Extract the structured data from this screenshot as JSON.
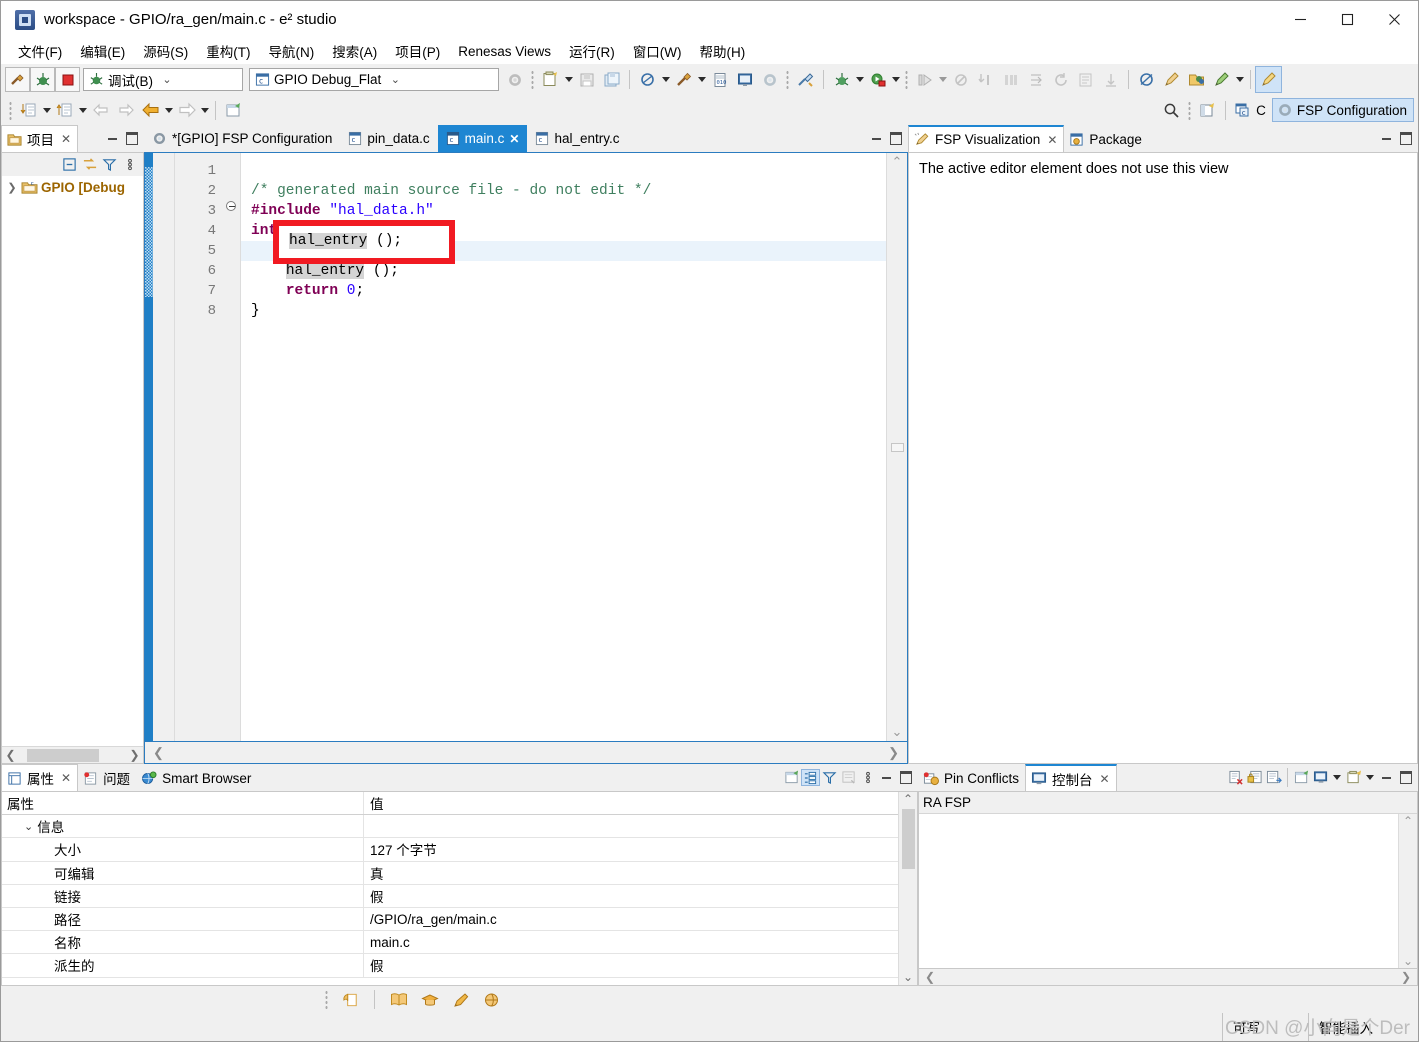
{
  "window": {
    "title": "workspace - GPIO/ra_gen/main.c - e² studio",
    "app_icon": "e2studio-icon",
    "controls": {
      "minimize": "minimize-icon",
      "maximize": "maximize-icon",
      "close": "close-icon"
    }
  },
  "menubar": [
    {
      "label": "文件(F)",
      "name": "menu-file"
    },
    {
      "label": "编辑(E)",
      "name": "menu-edit"
    },
    {
      "label": "源码(S)",
      "name": "menu-source"
    },
    {
      "label": "重构(T)",
      "name": "menu-refactor"
    },
    {
      "label": "导航(N)",
      "name": "menu-navigate"
    },
    {
      "label": "搜索(A)",
      "name": "menu-search"
    },
    {
      "label": "项目(P)",
      "name": "menu-project"
    },
    {
      "label": "Renesas Views",
      "name": "menu-renesas-views"
    },
    {
      "label": "运行(R)",
      "name": "menu-run"
    },
    {
      "label": "窗口(W)",
      "name": "menu-window"
    },
    {
      "label": "帮助(H)",
      "name": "menu-help"
    }
  ],
  "toolbar": {
    "build_tip": "build-icon",
    "debug_tip": "debug-bug-icon",
    "stop_tip": "stop-icon",
    "launch_mode": {
      "value": "调试(B)",
      "icon": "debug-bug-icon"
    },
    "launch_config": {
      "value": "GPIO Debug_Flat",
      "icon": "c-project-icon"
    }
  },
  "perspective": {
    "search_icon": "search-icon",
    "open_perspective": "open-perspective-icon",
    "items": [
      {
        "label": "C",
        "icon": "c-perspective-icon",
        "active": false
      },
      {
        "label": "FSP Configuration",
        "icon": "gear-icon",
        "active": true
      }
    ]
  },
  "project_explorer": {
    "tab_label": "项目",
    "tab_icon": "project-explorer-icon",
    "tree": [
      {
        "label": "GPIO [Debug",
        "suffix": "",
        "expander": "collapsed"
      }
    ]
  },
  "editor": {
    "tabs": [
      {
        "label": "*[GPIO] FSP Configuration",
        "icon": "gear-icon",
        "active": false,
        "closeable": false
      },
      {
        "label": "pin_data.c",
        "icon": "c-file-icon",
        "active": false,
        "closeable": false
      },
      {
        "label": "main.c",
        "icon": "c-file-icon",
        "active": true,
        "closeable": true
      },
      {
        "label": "hal_entry.c",
        "icon": "c-file-icon",
        "active": false,
        "closeable": false
      }
    ],
    "line_numbers": [
      "1",
      "2",
      "3",
      "4",
      "5",
      "6",
      "7",
      "8"
    ],
    "code_lines": [
      {
        "n": 1,
        "text": "/* generated main source file - do not edit */"
      },
      {
        "n": 2,
        "text": "#include \"hal_data.h\""
      },
      {
        "n": 3,
        "text": "int main(void)"
      },
      {
        "n": 4,
        "text": "{"
      },
      {
        "n": 5,
        "text": "    hal_entry ();"
      },
      {
        "n": 6,
        "text": "    return 0;"
      },
      {
        "n": 7,
        "text": "}"
      },
      {
        "n": 8,
        "text": ""
      }
    ],
    "highlighted_token": "hal_entry",
    "annotation": {
      "shape": "rectangle",
      "color": "#f11a22",
      "target_line": 5
    },
    "current_line": 5
  },
  "right_view": {
    "tabs": [
      {
        "label": "FSP Visualization",
        "icon": "pencil-visualization-icon",
        "active": true,
        "closeable": true
      },
      {
        "label": "Package",
        "icon": "package-icon",
        "active": false,
        "closeable": false
      }
    ],
    "message": "The active editor element does not use this view"
  },
  "properties_view": {
    "tabs": [
      {
        "label": "属性",
        "icon": "properties-icon",
        "active": true,
        "closeable": true
      },
      {
        "label": "问题",
        "icon": "problems-icon",
        "active": false,
        "closeable": false
      },
      {
        "label": "Smart Browser",
        "icon": "smart-browser-icon",
        "active": false,
        "closeable": false
      }
    ],
    "columns": [
      "属性",
      "值"
    ],
    "rows": [
      {
        "indent": 0,
        "name": "信息",
        "value": "",
        "expander": "expanded"
      },
      {
        "indent": 1,
        "name": "大小",
        "value": "127 个字节"
      },
      {
        "indent": 1,
        "name": "可编辑",
        "value": "真"
      },
      {
        "indent": 1,
        "name": "链接",
        "value": "假"
      },
      {
        "indent": 1,
        "name": "路径",
        "value": "/GPIO/ra_gen/main.c"
      },
      {
        "indent": 1,
        "name": "名称",
        "value": "main.c"
      },
      {
        "indent": 1,
        "name": "派生的",
        "value": "假"
      }
    ],
    "toolbar_icons": [
      "pin-icon",
      "show-categories-icon",
      "filter-icon",
      "restore-defaults-icon",
      "view-menu-icon",
      "minimize-icon",
      "maximize-icon"
    ]
  },
  "console_view": {
    "tabs": [
      {
        "label": "Pin Conflicts",
        "icon": "pin-conflicts-icon",
        "active": false,
        "closeable": false
      },
      {
        "label": "控制台",
        "icon": "console-icon",
        "active": true,
        "closeable": true
      }
    ],
    "console_name": "RA FSP",
    "content": "",
    "toolbar_icons": [
      "clear-console-icon",
      "lock-scroll-icon",
      "show-console-icon",
      "pin-console-icon",
      "display-selected-console-icon",
      "open-console-icon",
      "minimize-icon",
      "maximize-icon"
    ]
  },
  "bottom_strip_icons": [
    "page-icon",
    "book-icon",
    "graduation-cap-icon",
    "pencil-icon",
    "globe-icon"
  ],
  "statusbar": {
    "writable": "可写",
    "insert_mode": "智能插入"
  },
  "watermark": "CSDN @小向是个Der",
  "colors": {
    "accent_blue": "#1e86d2",
    "annotation_red": "#f11a22",
    "comment_green": "#3f7f5f",
    "keyword_purple": "#7f0055",
    "string_blue": "#2a00ff",
    "tree_amber": "#9c6500"
  }
}
